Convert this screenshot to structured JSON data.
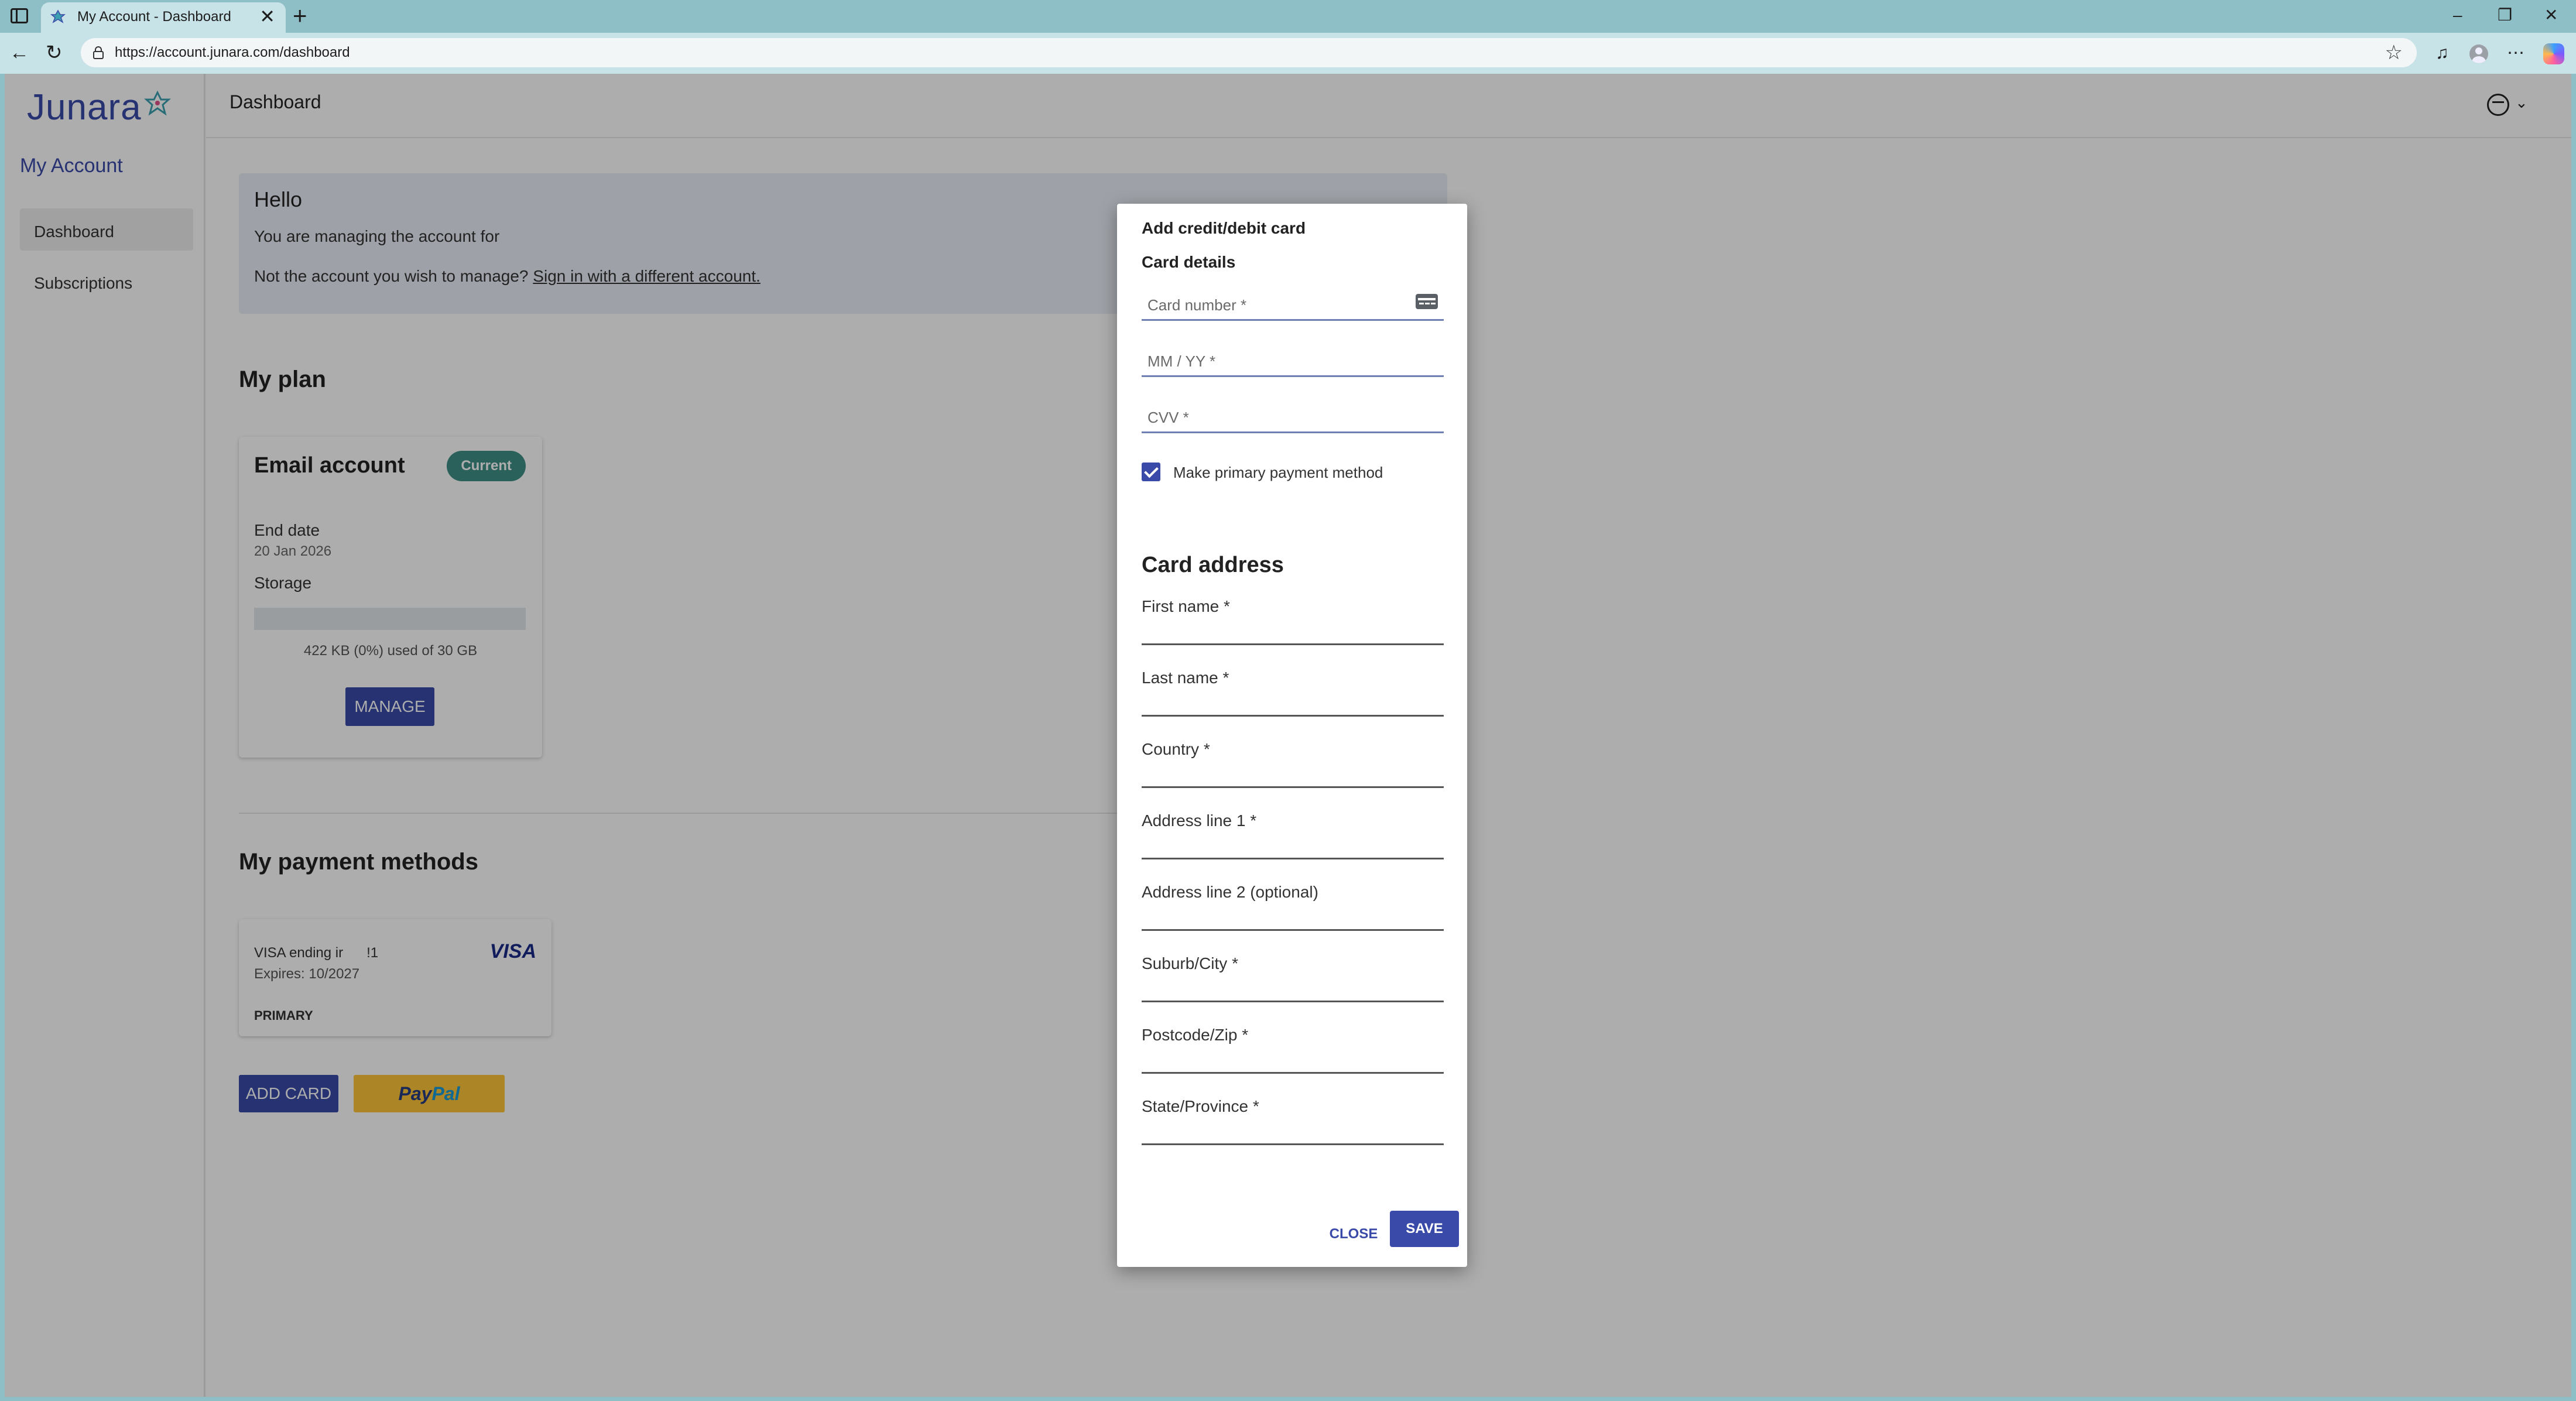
{
  "browser": {
    "tab_title": "My Account - Dashboard",
    "tab_close": "✕",
    "new_tab": "+",
    "url": "https://account.junara.com/dashboard",
    "back": "←",
    "reload": "↻",
    "star": "☆",
    "extensions": "♫",
    "more": "⋯",
    "minimize": "–",
    "restore": "❐",
    "close": "✕"
  },
  "sidebar": {
    "logo": "Junara",
    "title": "My Account",
    "items": [
      {
        "label": "Dashboard",
        "active": true
      },
      {
        "label": "Subscriptions",
        "active": false
      }
    ]
  },
  "header": {
    "page_title": "Dashboard",
    "user_menu_chevron": "⌄"
  },
  "hello": {
    "heading": "Hello",
    "managing_text": "You are managing the account for",
    "switch_prompt": "Not the account you wish to manage?",
    "switch_link": "Sign in with a different account."
  },
  "plan": {
    "section_title": "My plan",
    "name": "Email account",
    "badge": "Current",
    "end_date_label": "End date",
    "end_date_value": "20 Jan 2026",
    "storage_label": "Storage",
    "storage_fraction": 0.0,
    "usage_text": "422 KB (0%) used of 30 GB",
    "manage_label": "MANAGE"
  },
  "payment": {
    "section_title": "My payment methods",
    "card_line": "VISA ending ir      !1",
    "card_expiry": "Expires: 10/2027",
    "card_brand": "VISA",
    "card_status": "PRIMARY",
    "add_card_label": "ADD CARD",
    "paypal_pay": "Pay",
    "paypal_pal": "Pal"
  },
  "dialog": {
    "title": "Add credit/debit card",
    "card_details_title": "Card details",
    "card_number_placeholder": "Card number *",
    "expiry_placeholder": "MM / YY *",
    "cvv_placeholder": "CVV *",
    "make_primary_label": "Make primary payment method",
    "make_primary_checked": true,
    "address_title": "Card address",
    "address_fields": [
      "First name *",
      "Last name *",
      "Country *",
      "Address line 1 *",
      "Address line 2 (optional)",
      "Suburb/City *",
      "Postcode/Zip *",
      "State/Province *"
    ],
    "close_label": "CLOSE",
    "save_label": "SAVE"
  },
  "colors": {
    "brand": "#3a4aa8",
    "badge": "#3f8f86",
    "paypal_yellow": "#fcc439"
  }
}
